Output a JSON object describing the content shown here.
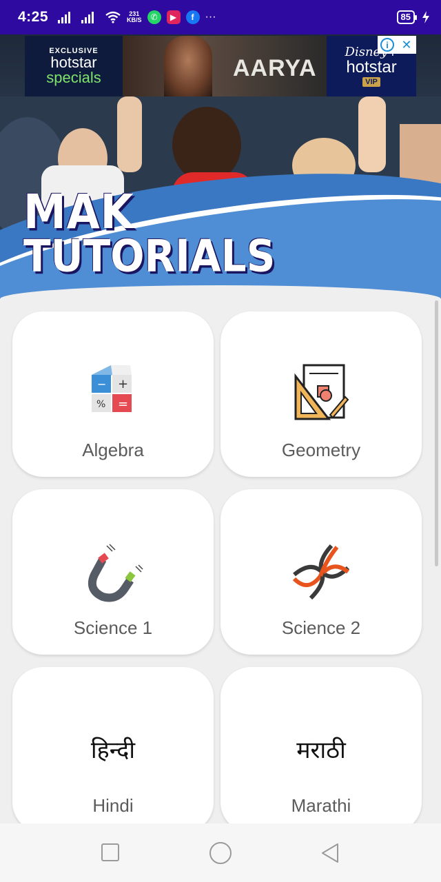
{
  "status_bar": {
    "time": "4:25",
    "speed_value": "231",
    "speed_unit": "KB/S",
    "more": "···",
    "battery": "85"
  },
  "banner": {
    "brand_line1": "MAK",
    "brand_line2": "TUTORIALS"
  },
  "ad": {
    "left_exclusive": "EXCLUSIVE",
    "left_hotstar": "hotstar",
    "left_specials": "specials",
    "title": "AARYA",
    "right_disney": "Disney+",
    "right_hotstar": "hotstar",
    "right_vip": "VIP",
    "info": "i",
    "close": "✕"
  },
  "subjects": [
    {
      "label": "Algebra",
      "icon": "calculator-blocks-icon"
    },
    {
      "label": "Geometry",
      "icon": "geometry-tools-icon"
    },
    {
      "label": "Science 1",
      "icon": "magnet-icon"
    },
    {
      "label": "Science 2",
      "icon": "dna-icon"
    },
    {
      "label": "Hindi",
      "icon": "hindi-script-icon",
      "script": "हिन्दी"
    },
    {
      "label": "Marathi",
      "icon": "marathi-script-icon",
      "script": "मराठी"
    }
  ],
  "colors": {
    "status_bar": "#2f0aa0",
    "banner_blue": "#3b78c4",
    "card_bg": "#ffffff",
    "page_bg": "#efefef",
    "label_gray": "#5b5b5b"
  }
}
